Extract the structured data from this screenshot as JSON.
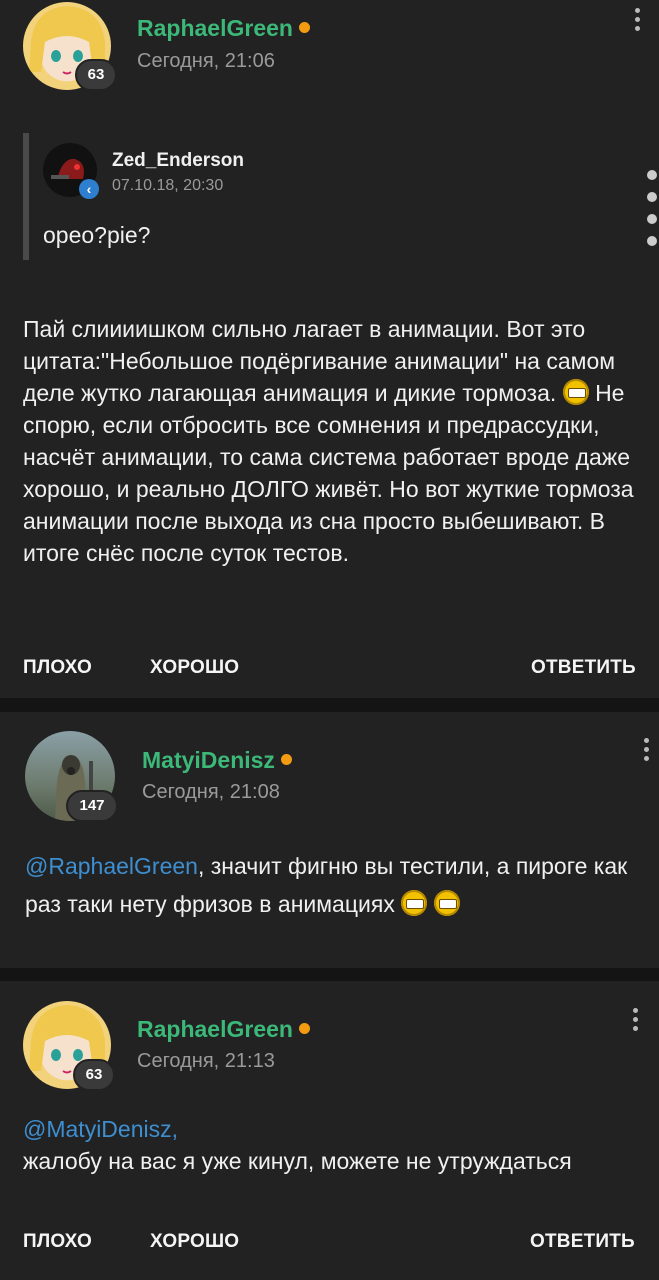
{
  "posts": [
    {
      "username": "RaphaelGreen",
      "badge": "63",
      "time": "Сегодня, 21:06",
      "quote": {
        "username": "Zed_Enderson",
        "time": "07.10.18, 20:30",
        "text": "opeo?pie?"
      },
      "text_a": "Пай слиииишком сильно лагает в анимации. Вот это цитата:\"Небольшое подёргивание анимации\" на самом деле жутко лагающая анимация и дикие тормоза.",
      "text_b": "Не спорю, если отбросить все сомнения и предрассудки, насчёт анимации, то сама система работает вроде даже хорошо, и реально ДОЛГО живёт. Но вот жуткие тормоза анимации после выхода из сна просто выбешивают. В итоге снёс после суток тестов.",
      "actions": {
        "bad": "ПЛОХО",
        "good": "ХОРОШО",
        "reply": "ОТВЕТИТЬ"
      }
    },
    {
      "username": "MatyiDenisz",
      "badge": "147",
      "time": "Сегодня, 21:08",
      "mention": "@RaphaelGreen",
      "text": ", значит фигню вы тестили, а пироге как раз таки нету фризов в анимациях"
    },
    {
      "username": "RaphaelGreen",
      "badge": "63",
      "time": "Сегодня, 21:13",
      "mention": "@MatyiDenisz,",
      "text": "жалобу на вас я уже кинул, можете не утруждаться",
      "actions": {
        "bad": "ПЛОХО",
        "good": "ХОРОШО",
        "reply": "ОТВЕТИТЬ"
      }
    }
  ],
  "colors": {
    "background": "#222222",
    "username": "#3cb878",
    "online": "#f39c12",
    "mention": "#3d8fd1"
  },
  "icons": {
    "menu": "kebab-icon",
    "emoji": "emoji-icon",
    "online": "online-dot-icon"
  }
}
